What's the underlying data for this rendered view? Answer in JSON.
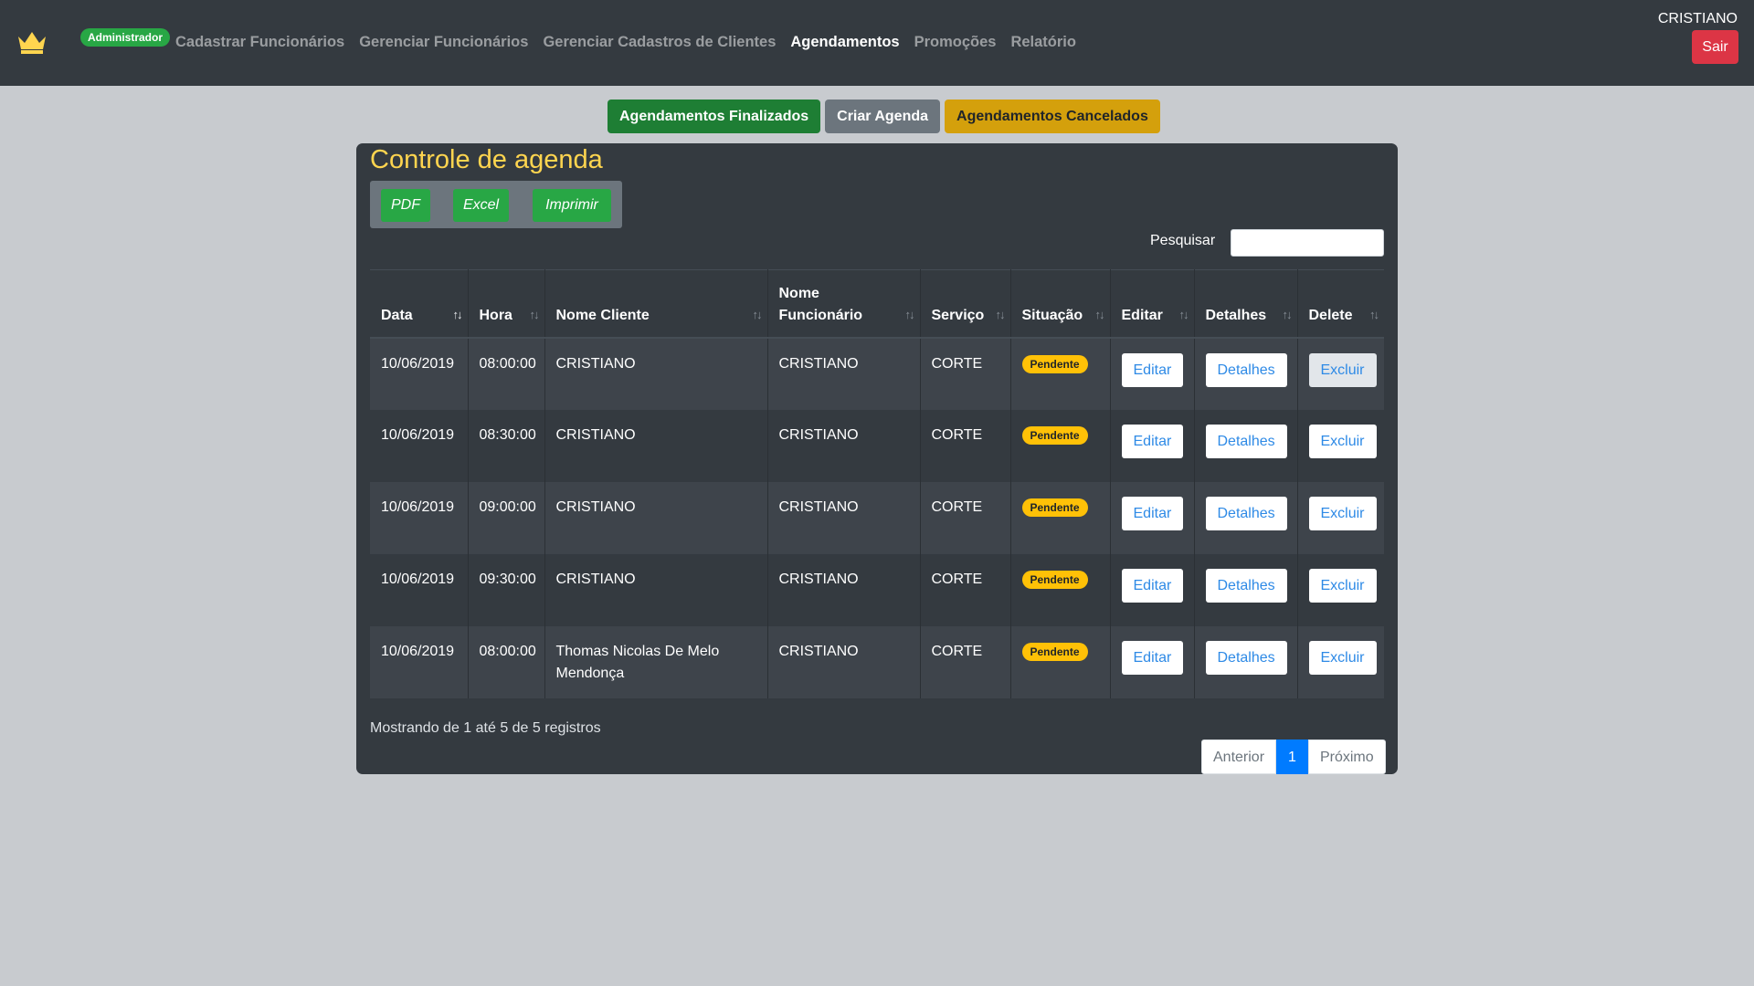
{
  "navbar": {
    "badge": "Administrador",
    "links": [
      {
        "label": "Cadastrar Funcionários",
        "active": false
      },
      {
        "label": "Gerenciar Funcionários",
        "active": false
      },
      {
        "label": "Gerenciar Cadastros de Clientes",
        "active": false
      },
      {
        "label": "Agendamentos",
        "active": true
      },
      {
        "label": "Promoções",
        "active": false
      },
      {
        "label": "Relatório",
        "active": false
      }
    ],
    "user": "CRISTIANO",
    "logout_label": "Sair",
    "logo_icon": "crown-icon",
    "logo_color": "#ffd54f"
  },
  "top_actions": {
    "finalizados": "Agendamentos Finalizados",
    "criar": "Criar Agenda",
    "cancelados": "Agendamentos Cancelados"
  },
  "panel": {
    "title": "Controle de agenda",
    "export": {
      "pdf": "PDF",
      "excel": "Excel",
      "imprimir": "Imprimir"
    },
    "search_label": "Pesquisar",
    "search_value": ""
  },
  "table": {
    "columns": [
      "Data",
      "Hora",
      "Nome Cliente",
      "Nome Funcionário",
      "Serviço",
      "Situação",
      "Editar",
      "Detalhes",
      "Delete"
    ],
    "rows": [
      {
        "data": "10/06/2019",
        "hora": "08:00:00",
        "cliente": "CRISTIANO",
        "funcionario": "CRISTIANO",
        "servico": "CORTE",
        "situacao": "Pendente",
        "editar": "Editar",
        "detalhes": "Detalhes",
        "excluir": "Excluir"
      },
      {
        "data": "10/06/2019",
        "hora": "08:30:00",
        "cliente": "CRISTIANO",
        "funcionario": "CRISTIANO",
        "servico": "CORTE",
        "situacao": "Pendente",
        "editar": "Editar",
        "detalhes": "Detalhes",
        "excluir": "Excluir"
      },
      {
        "data": "10/06/2019",
        "hora": "09:00:00",
        "cliente": "CRISTIANO",
        "funcionario": "CRISTIANO",
        "servico": "CORTE",
        "situacao": "Pendente",
        "editar": "Editar",
        "detalhes": "Detalhes",
        "excluir": "Excluir"
      },
      {
        "data": "10/06/2019",
        "hora": "09:30:00",
        "cliente": "CRISTIANO",
        "funcionario": "CRISTIANO",
        "servico": "CORTE",
        "situacao": "Pendente",
        "editar": "Editar",
        "detalhes": "Detalhes",
        "excluir": "Excluir"
      },
      {
        "data": "10/06/2019",
        "hora": "08:00:00",
        "cliente": "Thomas Nicolas De Melo Mendonça",
        "funcionario": "CRISTIANO",
        "servico": "CORTE",
        "situacao": "Pendente",
        "editar": "Editar",
        "detalhes": "Detalhes",
        "excluir": "Excluir"
      }
    ]
  },
  "info": "Mostrando de 1 até 5 de 5 registros",
  "pagination": {
    "prev": "Anterior",
    "current": "1",
    "next": "Próximo"
  },
  "colors": {
    "navbar": "#343a40",
    "page_bg": "#c8cbcf",
    "success": "#28a745",
    "danger": "#dc3545",
    "warning": "#ffc107",
    "primary": "#007bff",
    "title": "#ffd54f"
  }
}
